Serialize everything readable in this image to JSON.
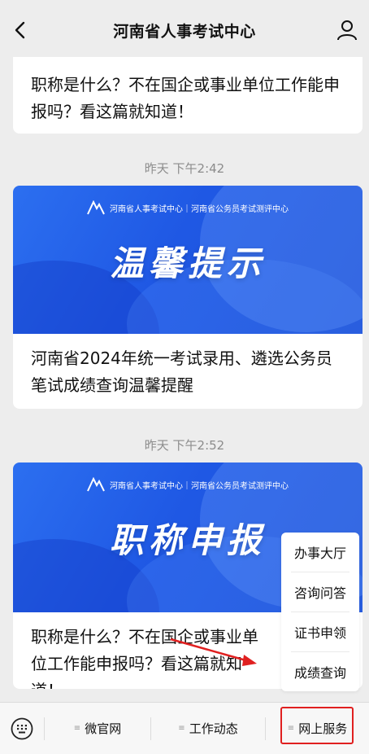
{
  "header": {
    "title": "河南省人事考试中心",
    "back_icon": "chevron-left-icon",
    "profile_icon": "user-icon"
  },
  "messages": [
    {
      "title": "职称是什么？不在国企或事业单位工作能申报吗？看这篇就知道！"
    },
    {
      "timestamp": "昨天 下午2:42",
      "banner_brand": "河南省人事考试中心｜河南省公务员考试测评中心",
      "banner_title": "温馨提示",
      "title": "河南省2024年统一考试录用、遴选公务员笔试成绩查询温馨提醒"
    },
    {
      "timestamp": "昨天 下午2:52",
      "banner_brand": "河南省人事考试中心｜河南省公务员考试测评中心",
      "banner_title": "职称申报",
      "title": "职称是什么？不在国企或事业单位工作能申报吗？看这篇就知道！"
    }
  ],
  "popup_menu": {
    "items": [
      "办事大厅",
      "咨询问答",
      "证书申领",
      "成绩查询"
    ]
  },
  "bottom_menu": {
    "keyboard_icon": "keyboard-icon",
    "items": [
      "微官网",
      "工作动态",
      "网上服务"
    ]
  },
  "colors": {
    "banner_blue": "#1f58e4",
    "highlight_red": "#e02020",
    "background": "#ededed"
  }
}
